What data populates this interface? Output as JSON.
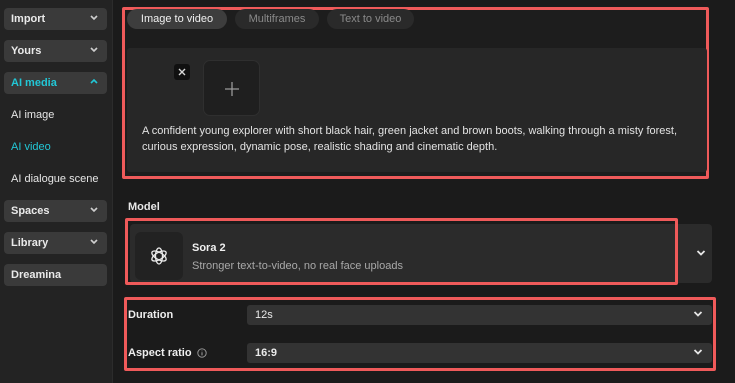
{
  "sidebar": {
    "items": [
      {
        "label": "Import",
        "type": "button"
      },
      {
        "label": "Yours",
        "type": "button"
      },
      {
        "label": "AI media",
        "type": "button",
        "active": true
      },
      {
        "label": "AI image",
        "type": "sub"
      },
      {
        "label": "AI video",
        "type": "sub",
        "active": true
      },
      {
        "label": "AI dialogue scene",
        "type": "sub"
      },
      {
        "label": "Spaces",
        "type": "button"
      },
      {
        "label": "Library",
        "type": "button"
      },
      {
        "label": "Dreamina",
        "type": "button"
      }
    ]
  },
  "tabs": [
    {
      "label": "Image to video",
      "active": true
    },
    {
      "label": "Multiframes"
    },
    {
      "label": "Text to video"
    }
  ],
  "prompt": {
    "text": "A confident young explorer with short black hair, green jacket and brown boots, walking through a misty forest, curious expression, dynamic pose, realistic shading and cinematic depth."
  },
  "model": {
    "section_label": "Model",
    "name": "Sora 2",
    "description": "Stronger text-to-video, no real face uploads"
  },
  "settings": {
    "duration_label": "Duration",
    "duration_value": "12s",
    "aspect_label": "Aspect ratio",
    "aspect_value": "16:9"
  },
  "colors": {
    "accent": "#22c7d6",
    "highlight_frame": "#ef5a5a"
  }
}
